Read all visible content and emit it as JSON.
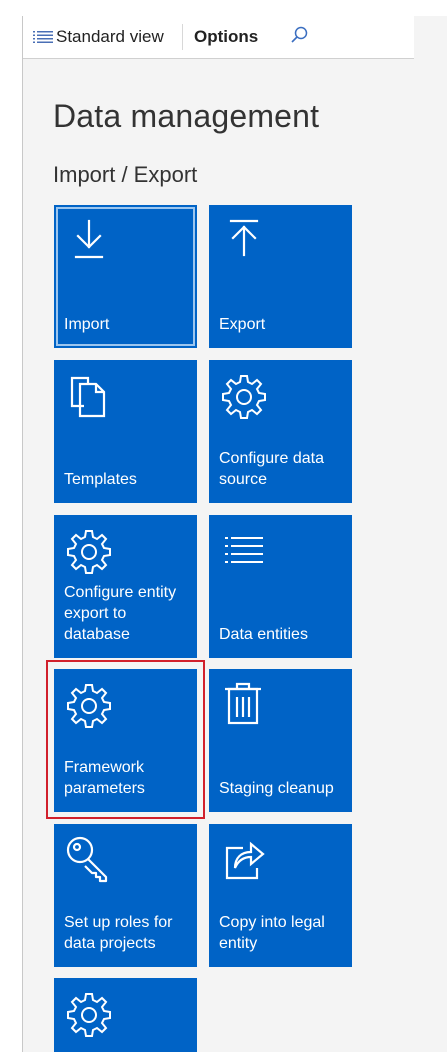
{
  "actionbar": {
    "standard_view_label": "Standard view",
    "options_label": "Options",
    "hamburger_icon": "hamburger-icon",
    "search_icon": "search-icon"
  },
  "page": {
    "title": "Data management",
    "section_title": "Import / Export"
  },
  "tiles": [
    {
      "label": "Import",
      "icon": "download-arrow-icon"
    },
    {
      "label": "Export",
      "icon": "upload-arrow-icon"
    },
    {
      "label": "Templates",
      "icon": "documents-icon"
    },
    {
      "label": "Configure data source",
      "icon": "gear-icon"
    },
    {
      "label": "Configure entity export to database",
      "icon": "gear-icon"
    },
    {
      "label": "Data entities",
      "icon": "list-icon"
    },
    {
      "label": "Framework parameters",
      "icon": "gear-icon"
    },
    {
      "label": "Staging cleanup",
      "icon": "trash-icon"
    },
    {
      "label": "Set up roles for data projects",
      "icon": "key-icon"
    },
    {
      "label": "Copy into legal entity",
      "icon": "share-icon"
    },
    {
      "label": "",
      "icon": "gear-icon"
    }
  ],
  "colors": {
    "tile_blue": "#0063c6",
    "highlight_red": "#d1202c",
    "background": "#f4f4f4"
  }
}
